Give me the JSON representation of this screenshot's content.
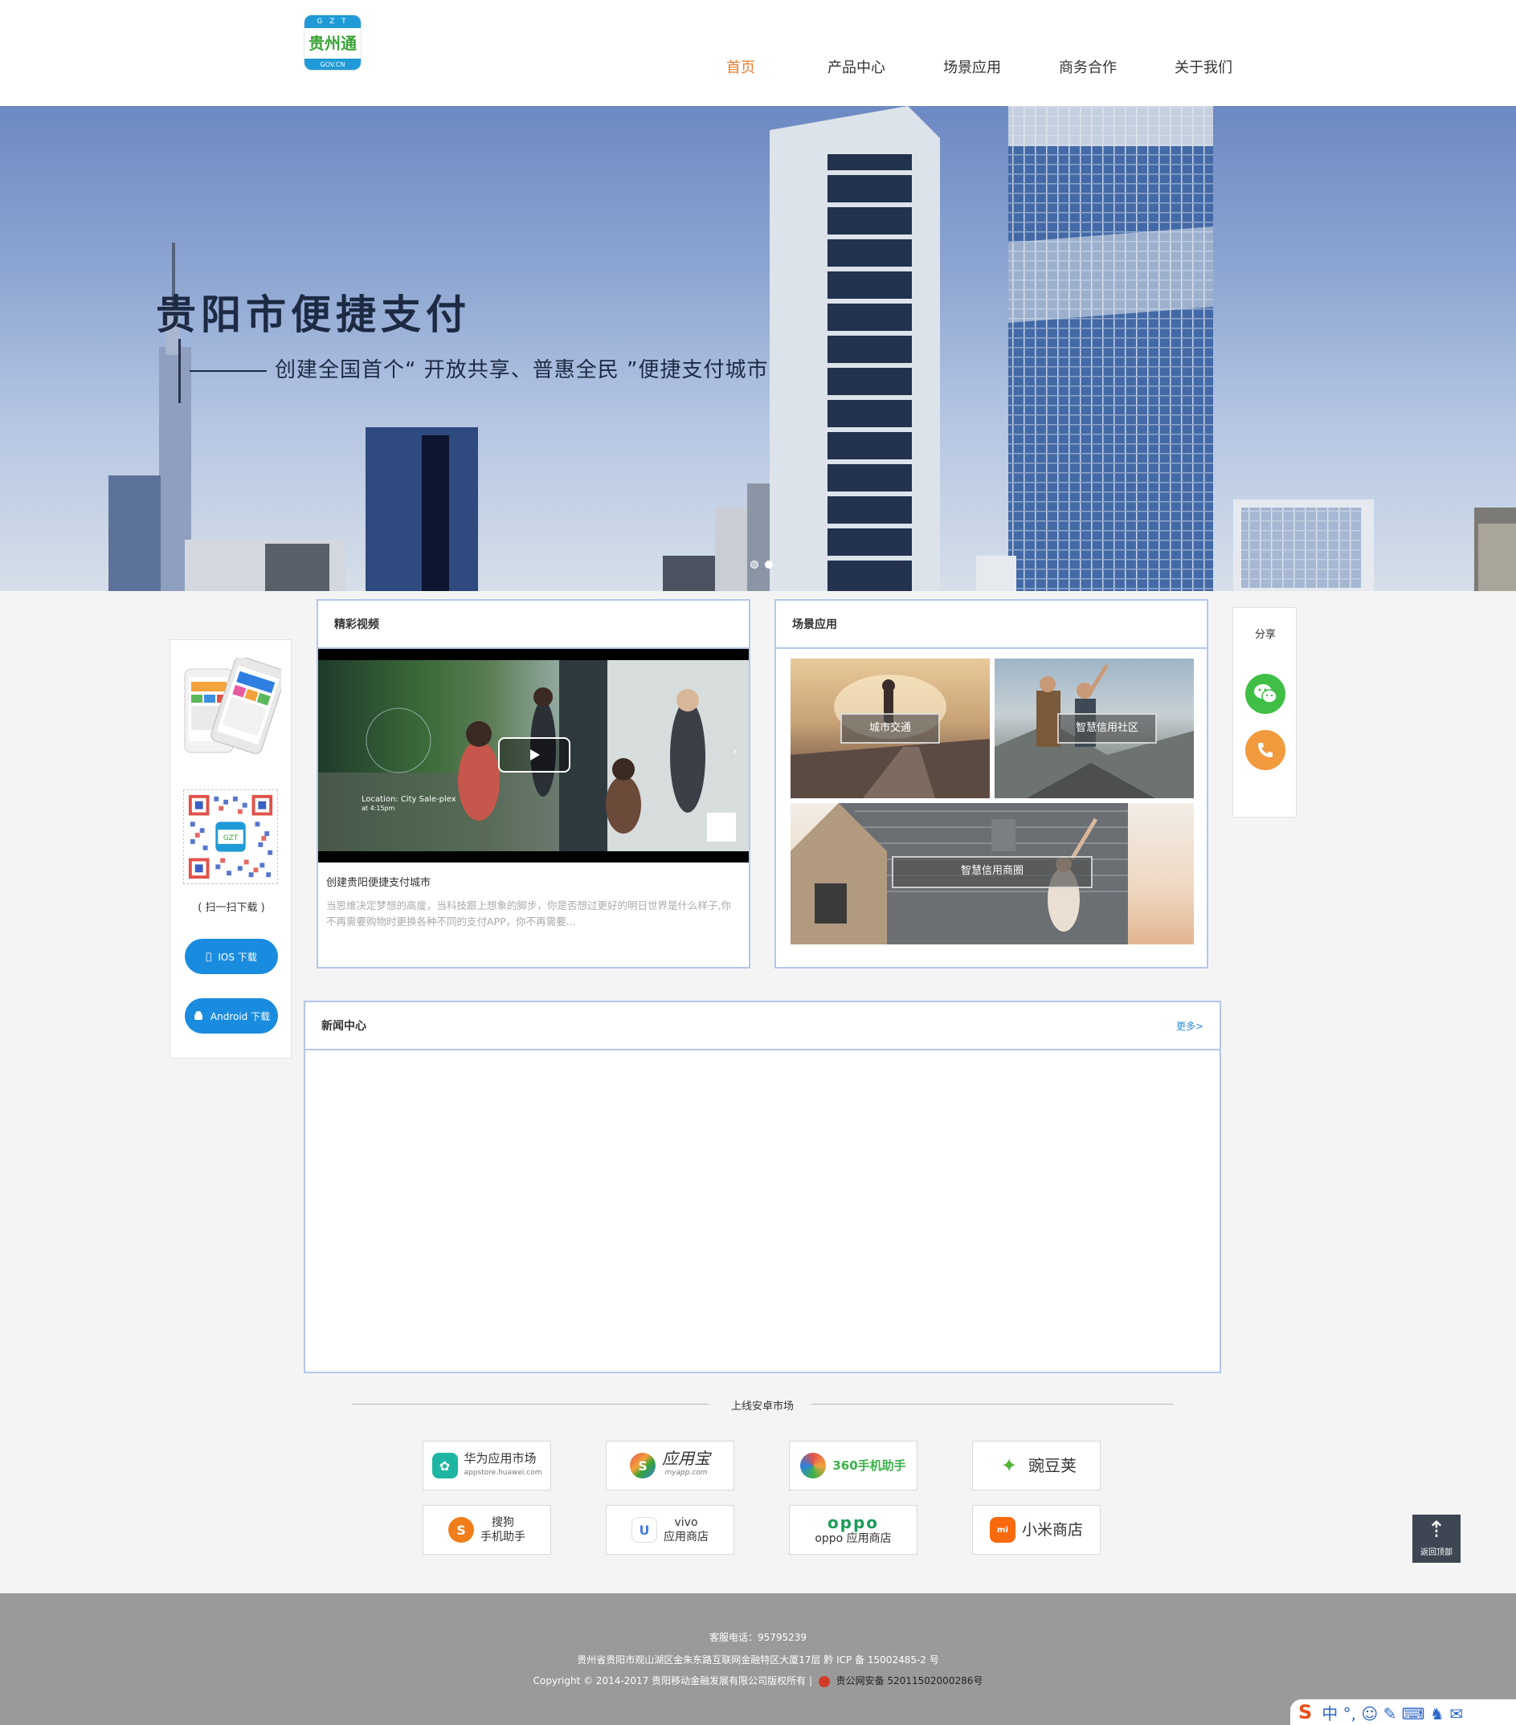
{
  "header": {
    "logo": {
      "top": "G Z T",
      "middle": "贵州通",
      "bottom": "GOV.CN"
    },
    "nav": [
      "首页",
      "产品中心",
      "场景应用",
      "商务合作",
      "关于我们"
    ],
    "active_index": 0,
    "active_color": "#ea7b2c"
  },
  "banner": {
    "title": "贵阳市便捷支付",
    "subtitle": "创建全国首个“ 开放共享、普惠全民 ”便捷支付城市",
    "slides": 2,
    "active_slide": 1
  },
  "app_card": {
    "qr_label": "( 扫一扫下载 )",
    "ios_label": "IOS 下载",
    "android_label": "Android 下载",
    "button_color": "#1a8ce0"
  },
  "video_panel": {
    "title": "精彩视频",
    "video_caption": "Location: City Sale-plex",
    "video_caption2": "at 4:15pm",
    "item_title": "创建贵阳便捷支付城市",
    "item_desc": "当思维决定梦想的高度，当科技跟上想象的脚步，你是否想过更好的明日世界是什么样子,你不再需要购物时更换各种不同的支付APP，你不再需要..."
  },
  "scene_panel": {
    "title": "场景应用",
    "tiles": [
      "城市交通",
      "智慧信用社区",
      "智慧信用商圈"
    ]
  },
  "news_panel": {
    "title": "新闻中心",
    "more": "更多>"
  },
  "share": {
    "title": "分享",
    "wechat_icon": "wechat-icon",
    "phone_icon": "phone-icon",
    "wechat_color": "#3fbf45",
    "phone_color": "#f19a3e"
  },
  "markets": {
    "title": "上线安卓市场",
    "items": [
      {
        "name": "华为应用市场",
        "sub": "appstore.huawei.com",
        "icon": "huawei-icon",
        "color": "#1eb6a2"
      },
      {
        "name": "应用宝",
        "sub": "myapp.com",
        "icon": "yingyongbao-icon",
        "color": "#2f7fe0"
      },
      {
        "name": "360手机助手",
        "sub": "",
        "icon": "360-icon",
        "color": "#3ab34a"
      },
      {
        "name": "豌豆荚",
        "sub": "",
        "icon": "wandoujia-icon",
        "color": "#54b435"
      },
      {
        "name": "搜狗\n手机助手",
        "sub": "",
        "icon": "sogou-icon",
        "color": "#f07d1a"
      },
      {
        "name": "vivo\n应用商店",
        "sub": "",
        "icon": "vivo-icon",
        "color": "#4a7ee0"
      },
      {
        "name": "oppo 应用商店",
        "sub": "oppo",
        "icon": "oppo-icon",
        "color": "#1b9d5a"
      },
      {
        "name": "小米商店",
        "sub": "",
        "icon": "xiaomi-icon",
        "color": "#f96a0e"
      }
    ]
  },
  "back_top": {
    "label": "返回顶部"
  },
  "footer": {
    "phone": "客服电话：95795239",
    "address": "贵州省贵阳市观山湖区金朱东路互联网金融特区大厦17层 黔 ICP 备 15002485-2 号",
    "copyright": "Copyright © 2014-2017 贵阳移动金融发展有限公司版权所有 |",
    "police": "贵公网安备 52011502000286号"
  },
  "ime": {
    "text": "中 °, ☺ ✎ ⌨ ♞ ✉"
  }
}
